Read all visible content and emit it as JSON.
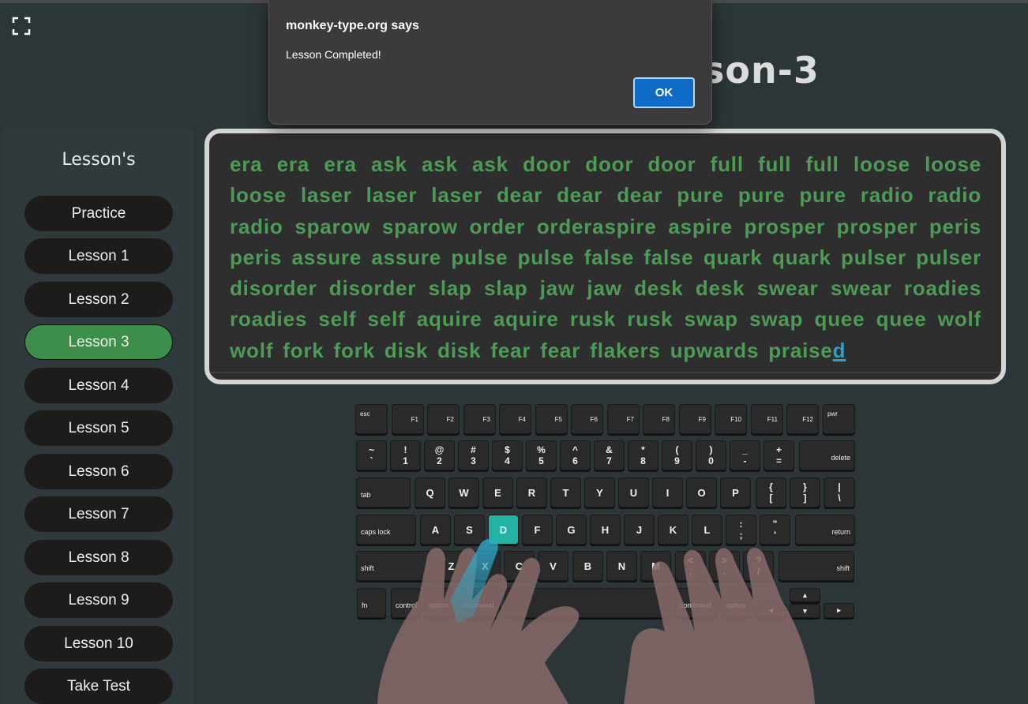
{
  "header": {
    "title_visible": "son-3"
  },
  "sidebar": {
    "title": "Lesson's",
    "items": [
      {
        "label": "Practice"
      },
      {
        "label": "Lesson 1"
      },
      {
        "label": "Lesson 2"
      },
      {
        "label": "Lesson 3"
      },
      {
        "label": "Lesson 4"
      },
      {
        "label": "Lesson 5"
      },
      {
        "label": "Lesson 6"
      },
      {
        "label": "Lesson 7"
      },
      {
        "label": "Lesson 8"
      },
      {
        "label": "Lesson 9"
      },
      {
        "label": "Lesson 10"
      },
      {
        "label": "Take Test"
      }
    ],
    "active_item": "Lesson 3"
  },
  "typing": {
    "text": "era era era ask ask ask door door door full full full loose loose loose laser laser laser dear dear dear pure pure pure radio radio radio sparow sparow order orderaspire aspire prosper prosper peris peris assure assure pulse pulse false false quark quark pulser pulser disorder disorder slap slap jaw jaw desk desk swear swear roadies roadies self self aquire aquire rusk rusk swap swap quee quee wolf wolf fork fork disk disk fear fear flakers upwards praise",
    "current_char": "d"
  },
  "keyboard": {
    "highlighted_key": "D",
    "rows": {
      "fn_row": [
        "esc",
        "F1",
        "F2",
        "F3",
        "F4",
        "F5",
        "F6",
        "F7",
        "F8",
        "F9",
        "F10",
        "F11",
        "F12",
        "pwr"
      ],
      "num_row": [
        [
          "~",
          "`"
        ],
        [
          "!",
          "1"
        ],
        [
          "@",
          "2"
        ],
        [
          "#",
          "3"
        ],
        [
          "$",
          "4"
        ],
        [
          "%",
          "5"
        ],
        [
          "^",
          "6"
        ],
        [
          "&",
          "7"
        ],
        [
          "*",
          "8"
        ],
        [
          "(",
          "9"
        ],
        [
          ")",
          "0"
        ],
        [
          "_",
          "-"
        ],
        [
          "+",
          "="
        ]
      ],
      "delete": "delete",
      "tab": "tab",
      "qwerty": [
        "Q",
        "W",
        "E",
        "R",
        "T",
        "Y",
        "U",
        "I",
        "O",
        "P"
      ],
      "brackets": [
        [
          "{",
          "["
        ],
        [
          "}",
          "]"
        ],
        [
          "|",
          "\\"
        ]
      ],
      "caps": "caps lock",
      "home": [
        "A",
        "S",
        "D",
        "F",
        "G",
        "H",
        "J",
        "K",
        "L"
      ],
      "home_punct": [
        [
          ":",
          ";"
        ],
        [
          "\"",
          "'"
        ]
      ],
      "return": "return",
      "shift": "shift",
      "bottom_letters": [
        "Z",
        "X",
        "C",
        "V",
        "B",
        "N",
        "M"
      ],
      "bottom_punct": [
        [
          "<",
          ","
        ],
        [
          ">",
          "."
        ],
        [
          "?",
          "/"
        ]
      ],
      "mods_left": [
        "fn",
        "control",
        "option",
        "command"
      ],
      "mods_right": [
        "command",
        "option"
      ],
      "arrows": [
        "◂",
        "▴",
        "▾",
        "▸"
      ]
    }
  },
  "dialog": {
    "title": "monkey-type.org says",
    "message": "Lesson Completed!",
    "ok_label": "OK"
  },
  "colors": {
    "background": "#2c3537",
    "typed_text": "#4e9a57",
    "active_lesson": "#3c8e4a",
    "highlight_key": "#23b3a5",
    "caret": "#2d9fc4",
    "ok_button": "#0f6cc6"
  }
}
